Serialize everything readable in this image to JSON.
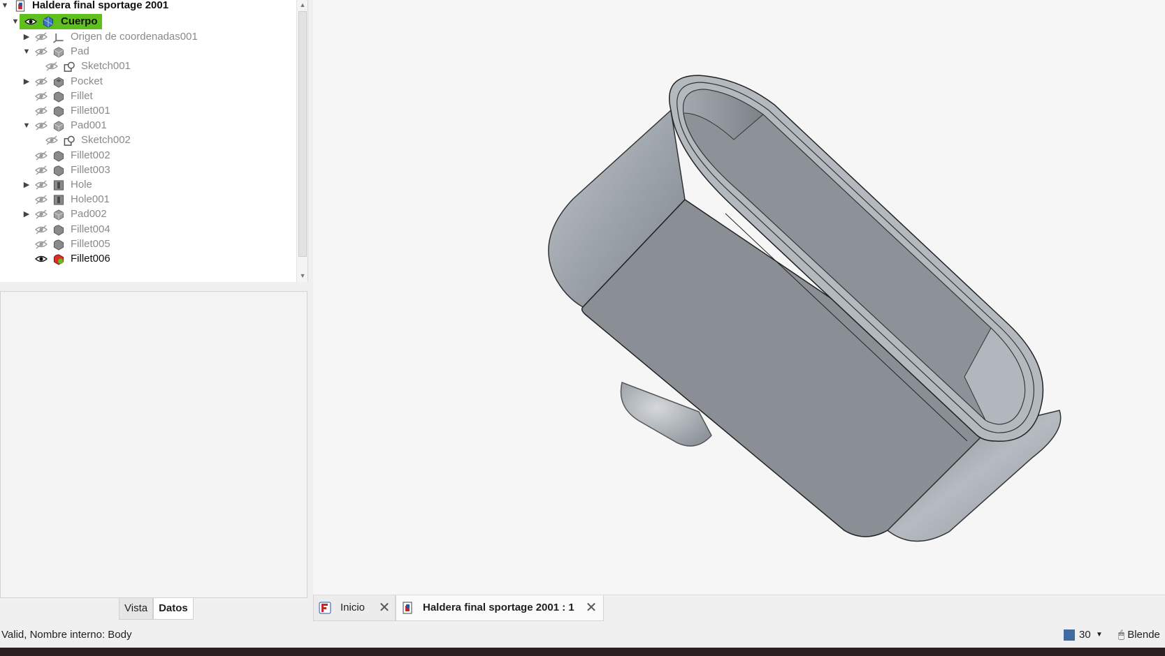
{
  "tree": {
    "root_label": "Haldera final sportage 2001",
    "body_label": "Cuerpo",
    "items": [
      {
        "label": "Origen de coordenadas001",
        "icon": "axis-origin-icon"
      },
      {
        "label": "Pad",
        "icon": "pad-feature-icon"
      },
      {
        "label": "Sketch001",
        "icon": "sketch-icon"
      },
      {
        "label": "Pocket",
        "icon": "pocket-feature-icon"
      },
      {
        "label": "Fillet",
        "icon": "fillet-feature-icon"
      },
      {
        "label": "Fillet001",
        "icon": "fillet-feature-icon"
      },
      {
        "label": "Pad001",
        "icon": "pad-feature-icon"
      },
      {
        "label": "Sketch002",
        "icon": "sketch-icon"
      },
      {
        "label": "Fillet002",
        "icon": "fillet-feature-icon"
      },
      {
        "label": "Fillet003",
        "icon": "fillet-feature-icon"
      },
      {
        "label": "Hole",
        "icon": "hole-feature-icon"
      },
      {
        "label": "Hole001",
        "icon": "hole-feature-icon"
      },
      {
        "label": "Pad002",
        "icon": "pad-feature-icon"
      },
      {
        "label": "Fillet004",
        "icon": "fillet-feature-icon"
      },
      {
        "label": "Fillet005",
        "icon": "fillet-feature-icon"
      },
      {
        "label": "Fillet006",
        "icon": "fillet-tip-icon"
      }
    ]
  },
  "property_tabs": {
    "vista": "Vista",
    "datos": "Datos"
  },
  "doc_tabs": {
    "start_label": "Inicio",
    "doc_label": "Haldera final sportage 2001 : 1"
  },
  "status": {
    "message": "Valid, Nombre interno: Body",
    "count": "30",
    "nav_style": "Blende"
  },
  "colors": {
    "highlight": "#5fbf1d",
    "model_face": "#8d9299",
    "viewport_bg": "#f6f6f6"
  }
}
